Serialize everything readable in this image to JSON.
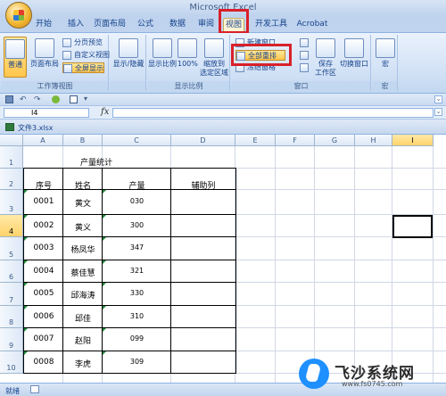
{
  "app": {
    "title": "Microsoft Excel"
  },
  "tabs": [
    {
      "label": "开始"
    },
    {
      "label": "插入"
    },
    {
      "label": "页面布局"
    },
    {
      "label": "公式"
    },
    {
      "label": "数据"
    },
    {
      "label": "审阅"
    },
    {
      "label": "视图"
    },
    {
      "label": "开发工具"
    },
    {
      "label": "Acrobat"
    }
  ],
  "active_tab": "视图",
  "ribbon": {
    "group1": {
      "label": "工作簿视图",
      "normal": "普通",
      "page_layout": "页面布局",
      "page_break": "分页预览",
      "custom_view": "自定义视图",
      "fullscreen": "全屏显示"
    },
    "group2": {
      "show_hide": "显示/隐藏"
    },
    "group3": {
      "label": "显示比例",
      "zoom": "显示比例",
      "zoom100": "100%",
      "zoom_selection_1": "缩放到",
      "zoom_selection_2": "选定区域"
    },
    "group4": {
      "label": "窗口",
      "new_window": "新建窗口",
      "arrange_all": "全部重排",
      "freeze_panes": "冻结窗格",
      "save_workspace_1": "保存",
      "save_workspace_2": "工作区",
      "switch_windows": "切换窗口"
    },
    "group5": {
      "label": "宏",
      "macros": "宏"
    }
  },
  "formula_bar": {
    "name_box": "I4",
    "fx": "fx",
    "formula": ""
  },
  "workbook": {
    "title": "文件3.xlsx"
  },
  "columns": [
    "A",
    "B",
    "C",
    "D",
    "E",
    "F",
    "G",
    "H",
    "I"
  ],
  "rows": [
    "1",
    "2",
    "3",
    "4",
    "5",
    "6",
    "7",
    "8",
    "9",
    "10"
  ],
  "sheet": {
    "title": "产量统计",
    "headers": [
      "序号",
      "姓名",
      "产量",
      "辅助列"
    ],
    "data": [
      [
        "0001",
        "黄文",
        "030"
      ],
      [
        "0002",
        "黄义",
        "300"
      ],
      [
        "0003",
        "杨凤华",
        "347"
      ],
      [
        "0004",
        "蔡佳慧",
        "321"
      ],
      [
        "0005",
        "邱海涛",
        "330"
      ],
      [
        "0006",
        "邱佳",
        "310"
      ],
      [
        "0007",
        "赵阳",
        "099"
      ],
      [
        "0008",
        "李虎",
        "309"
      ]
    ]
  },
  "status": {
    "text": "就绪"
  },
  "watermark": {
    "name": "飞沙系统网",
    "url": "www.fs0745.com"
  }
}
